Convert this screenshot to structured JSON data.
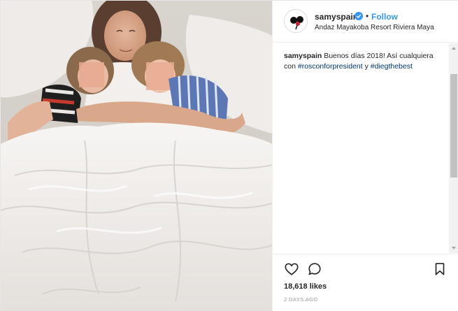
{
  "post": {
    "username": "samyspain",
    "separator": "•",
    "follow_label": "Follow",
    "location": "Andaz Mayakoba Resort Riviera Maya",
    "caption": {
      "username": "samyspain",
      "text_part1": " Buenos días 2018! Así cualquiera con ",
      "hashtag1": "#rosconforpresident",
      "text_part2": " y ",
      "hashtag2": "#diegthebest"
    },
    "likes": "18,618 likes",
    "date": "2 DAYS AGO"
  },
  "icons": {
    "avatar": "profile-avatar",
    "verified": "verified-badge-icon",
    "like": "heart-icon",
    "comment": "comment-icon",
    "save": "bookmark-icon"
  },
  "colors": {
    "follow": "#3897f0",
    "hashtag": "#003569",
    "verified": "#3897f0",
    "muted": "#999999"
  }
}
